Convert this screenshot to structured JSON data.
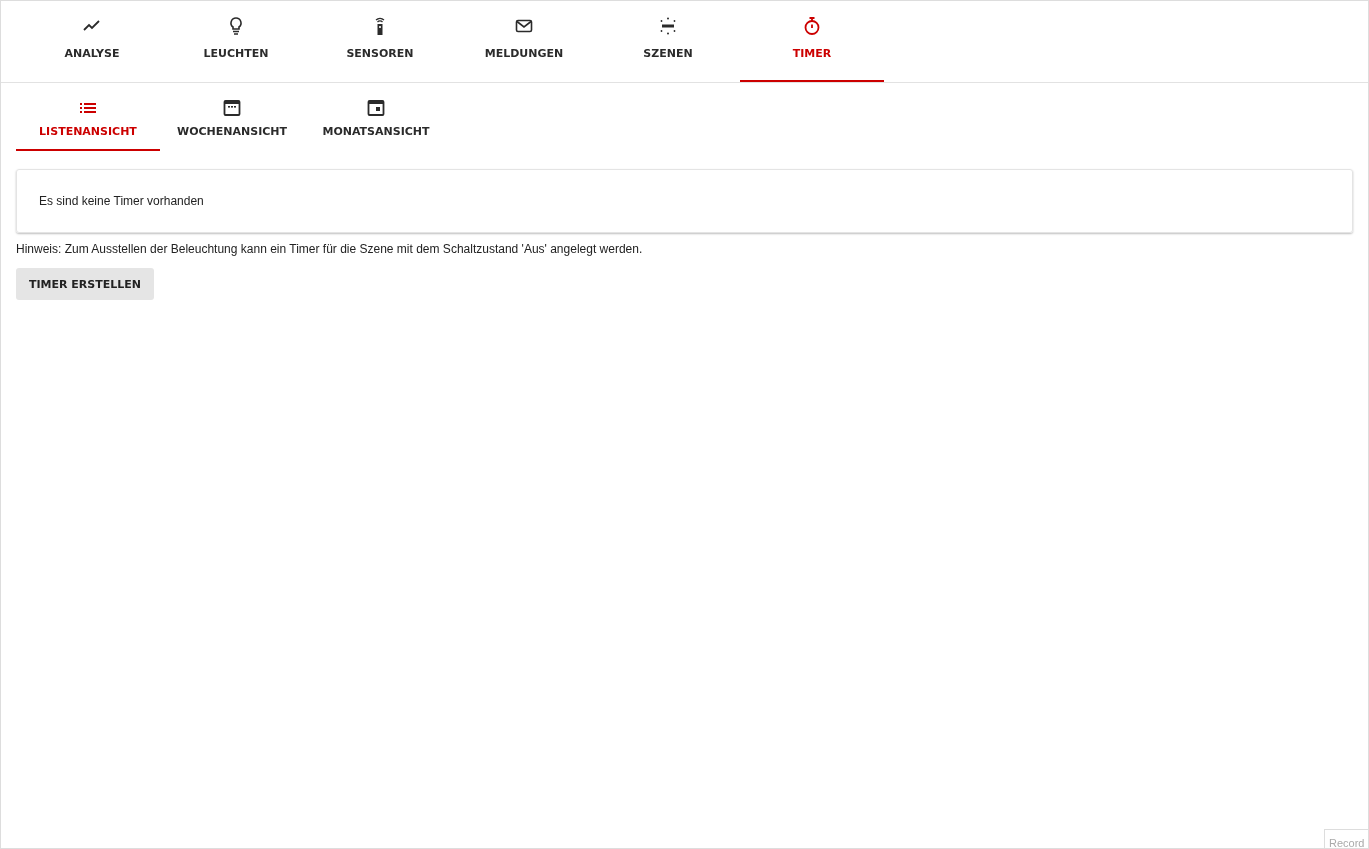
{
  "main_tabs": [
    {
      "label": "ANALYSE",
      "selected": false
    },
    {
      "label": "LEUCHTEN",
      "selected": false
    },
    {
      "label": "SENSOREN",
      "selected": false
    },
    {
      "label": "MELDUNGEN",
      "selected": false
    },
    {
      "label": "SZENEN",
      "selected": false
    },
    {
      "label": "TIMER",
      "selected": true
    }
  ],
  "view_tabs": [
    {
      "label": "LISTENANSICHT",
      "selected": true
    },
    {
      "label": "WOCHENANSICHT",
      "selected": false
    },
    {
      "label": "MONATSANSICHT",
      "selected": false
    }
  ],
  "empty_message": "Es sind keine Timer vorhanden",
  "hint": "Hinweis: Zum Ausstellen der Beleuchtung kann ein Timer für die Szene mit dem Schaltzustand 'Aus' angelegt werden.",
  "create_button": "TIMER ERSTELLEN",
  "record_widget": "Record"
}
